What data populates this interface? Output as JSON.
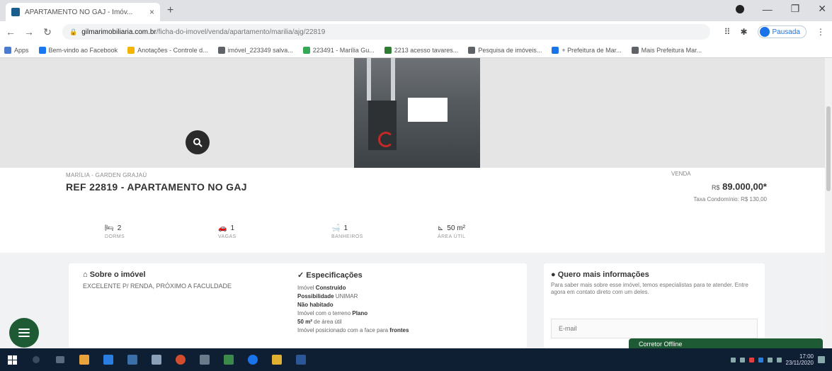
{
  "browser": {
    "tab_title": "APARTAMENTO NO GAJ - Imóv...",
    "tab_close": "×",
    "new_tab": "+",
    "url_host": "gilmarimobiliaria.com.br",
    "url_path": "/ficha-do-imovel/venda/apartamento/marilia/ajg/22819",
    "profile_label": "Pausada",
    "bookmarks": [
      {
        "label": "Apps",
        "color": "#4a7bd0"
      },
      {
        "label": "Bem-vindo ao Facebook",
        "color": "#1877f2"
      },
      {
        "label": "Anotações - Controle d...",
        "color": "#f4b400"
      },
      {
        "label": "imóvel_223349 salva...",
        "color": "#5f6368"
      },
      {
        "label": "223491 - Marília Gu...",
        "color": "#34a853"
      },
      {
        "label": "2213 acesso tavares...",
        "color": "#2e7d32"
      },
      {
        "label": "Pesquisa de imóveis...",
        "color": "#5f6368"
      },
      {
        "label": "+ Prefeitura de Mar...",
        "color": "#1a73e8"
      },
      {
        "label": "Mais Prefeitura Mar...",
        "color": "#5f6368"
      }
    ]
  },
  "listing": {
    "breadcrumb": "MARÍLIA - GARDEN GRAJAÚ",
    "title": "REF 22819 - APARTAMENTO NO GAJ",
    "price_label": "VENDA",
    "price_prefix": "R$",
    "price": "89.000,00*",
    "tax_note": "Taxa Condomínio: R$ 130,00",
    "features": [
      {
        "icon": "bed-icon",
        "glyph": "🛏",
        "value": "2",
        "label": "DORMS"
      },
      {
        "icon": "car-icon",
        "glyph": "🚗",
        "value": "1",
        "label": "VAGAS"
      },
      {
        "icon": "bath-icon",
        "glyph": "🛁",
        "value": "1",
        "label": "BANHEIROS"
      },
      {
        "icon": "area-icon",
        "glyph": "⊾",
        "value": "50 m²",
        "label": "ÁREA ÚTIL"
      }
    ]
  },
  "about": {
    "heading": "Sobre o imóvel",
    "text": "EXCELENTE P/ RENDA, PRÓXIMO A FACULDADE"
  },
  "specs": {
    "heading": "Especificações",
    "items": [
      {
        "pre": "Imóvel ",
        "bold": "Construído",
        "post": ""
      },
      {
        "pre": "",
        "bold": "Possibilidade",
        "post": " UNIMAR"
      },
      {
        "pre": "",
        "bold": "Não habitado",
        "post": ""
      },
      {
        "pre": "Imóvel com o terreno ",
        "bold": "Plano",
        "post": ""
      },
      {
        "pre": "",
        "bold": "50 m²",
        "post": " de área útil"
      },
      {
        "pre": "Imóvel posicionado com a face para ",
        "bold": "frontes",
        "post": ""
      }
    ]
  },
  "contact": {
    "heading": "Quero mais informações",
    "text": "Para saber mais sobre esse imóvel, temos especialistas para te atender. Entre agora em contato direto com um deles.",
    "email_placeholder": "E-mail"
  },
  "chat": {
    "label": "Corretor Offline"
  },
  "taskbar": {
    "time": "17:00",
    "date": "23/11/2020"
  },
  "colors": {
    "accent": "#1e5b34",
    "taskbar": "#0f1f33"
  }
}
